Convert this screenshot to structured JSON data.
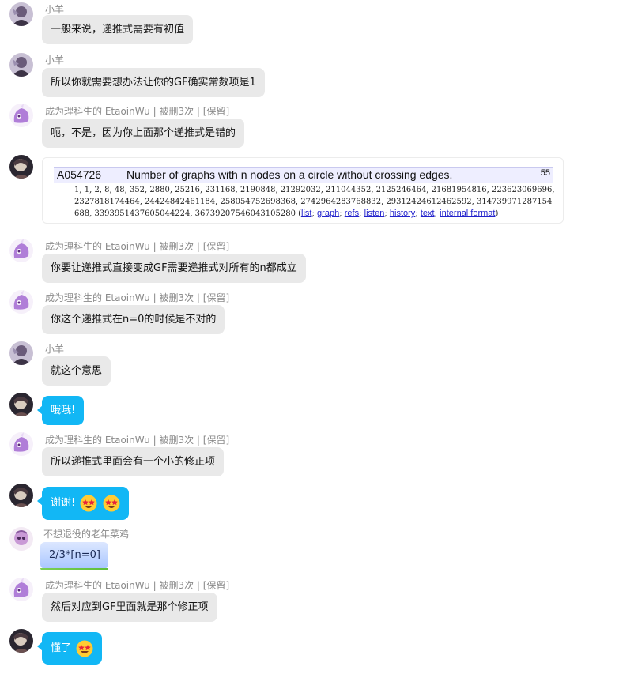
{
  "colors": {
    "self_bubble": "#12b7f5",
    "other_bubble": "#e9e9e9",
    "sender_text": "#8a8a8a"
  },
  "messages": [
    {
      "sender": "小羊",
      "text": "一般来说，递推式需要有初值",
      "type": "other",
      "avatar": "avatar-xiaoyang"
    },
    {
      "sender": "小羊",
      "text": "所以你就需要想办法让你的GF确实常数项是1",
      "type": "other",
      "avatar": "avatar-xiaoyang"
    },
    {
      "sender": "成为理科生的 EtaoinWu | 被删3次 | [保留]",
      "text": "呃，不是，因为你上面那个递推式是错的",
      "type": "other",
      "avatar": "avatar-etaoinwu"
    },
    {
      "sender": "",
      "text": "",
      "type": "image",
      "avatar": "avatar-self"
    },
    {
      "sender": "成为理科生的 EtaoinWu | 被删3次 | [保留]",
      "text": "你要让递推式直接变成GF需要递推式对所有的n都成立",
      "type": "other",
      "avatar": "avatar-etaoinwu"
    },
    {
      "sender": "成为理科生的 EtaoinWu | 被删3次 | [保留]",
      "text": "你这个递推式在n=0的时候是不对的",
      "type": "other",
      "avatar": "avatar-etaoinwu"
    },
    {
      "sender": "小羊",
      "text": "就这个意思",
      "type": "other",
      "avatar": "avatar-xiaoyang"
    },
    {
      "sender": "",
      "text": "哦哦!",
      "type": "self",
      "avatar": "avatar-self"
    },
    {
      "sender": "成为理科生的 EtaoinWu | 被删3次 | [保留]",
      "text": "所以递推式里面会有一个小的修正项",
      "type": "other",
      "avatar": "avatar-etaoinwu"
    },
    {
      "sender": "",
      "text": "谢谢!",
      "type": "self",
      "avatar": "avatar-self",
      "emojis": [
        "star-struck-emoji",
        "star-struck-emoji"
      ]
    },
    {
      "sender": "不想退役的老年菜鸡",
      "text": "2/3*[n=0]",
      "type": "special",
      "avatar": "avatar-oldbird"
    },
    {
      "sender": "成为理科生的 EtaoinWu | 被删3次 | [保留]",
      "text": "然后对应到GF里面就是那个修正项",
      "type": "other",
      "avatar": "avatar-etaoinwu"
    },
    {
      "sender": "",
      "text": "懂了",
      "type": "self",
      "avatar": "avatar-self",
      "emojis": [
        "star-struck-emoji"
      ]
    }
  ],
  "oeis": {
    "id": "A054726",
    "title": "Number of graphs with n nodes on a circle without crossing edges.",
    "count": "55",
    "sequence": "1, 1, 2, 8, 48, 352, 2880, 25216, 231168, 2190848, 21292032, 211044352, 2125246464, 21681954816, 223623069696, 2327818174464, 24424842461184, 258054752698368, 2742964283768832, 29312424612462592, 314739971287154688, 3393951437605044224, 36739207546043105280",
    "links": [
      "list",
      "graph",
      "refs",
      "listen",
      "history",
      "text",
      "internal format"
    ]
  }
}
